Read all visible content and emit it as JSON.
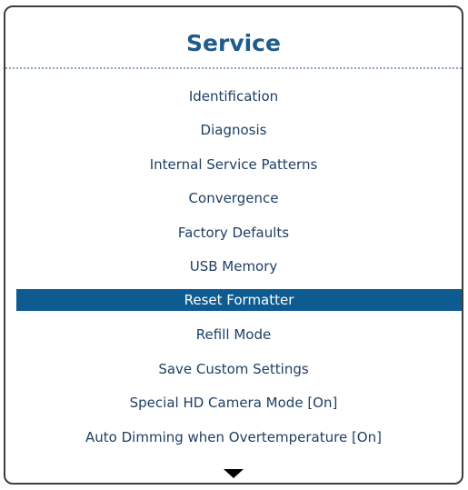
{
  "menu": {
    "title": "Service",
    "items": [
      {
        "label": "Identification"
      },
      {
        "label": "Diagnosis"
      },
      {
        "label": "Internal Service Patterns"
      },
      {
        "label": "Convergence"
      },
      {
        "label": "Factory Defaults"
      },
      {
        "label": "USB Memory"
      },
      {
        "label": "Reset Formatter",
        "selected": true
      },
      {
        "label": "Refill Mode"
      },
      {
        "label": "Save Custom Settings"
      },
      {
        "label": "Special HD Camera Mode [On]"
      },
      {
        "label": "Auto Dimming when Overtemperature [On]"
      }
    ],
    "scroll_indicator_icon": "triangle-down-icon",
    "colors": {
      "title": "#1f5b8b",
      "item_text": "#1e3f64",
      "selected_background": "#0e5b91",
      "selected_text": "#ffffff",
      "divider": "#8fa6bb",
      "frame_border": "#3d3d3d"
    }
  }
}
